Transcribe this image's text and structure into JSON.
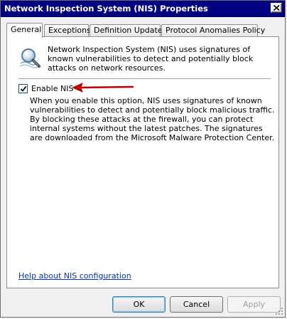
{
  "window": {
    "title": "Network Inspection System (NIS) Properties"
  },
  "tabs": [
    {
      "label": "General",
      "active": true
    },
    {
      "label": "Exceptions",
      "active": false
    },
    {
      "label": "Definition Updates",
      "active": false
    },
    {
      "label": "Protocol Anomalies Policy",
      "active": false
    }
  ],
  "general": {
    "intro_icon": "magnifier-inspection-icon",
    "intro_text": "Network Inspection System (NIS) uses signatures of known vulnerabilities to detect and potentially block attacks on network resources.",
    "enable_checkbox": {
      "label": "Enable NIS",
      "checked": true
    },
    "enable_description": "When you enable this option, NIS uses signatures of known vulnerabilities to detect and potentially block malicious traffic. By blocking these attacks at the firewall, you can protect internal systems without the latest patches. The signatures are downloaded from the Microsoft Malware Protection Center.",
    "help_link": "Help about NIS configuration"
  },
  "buttons": {
    "ok": "OK",
    "cancel": "Cancel",
    "apply": "Apply",
    "apply_enabled": false
  },
  "colors": {
    "titlebar": "#000080",
    "arrow": "#c00000",
    "link": "#0033cc"
  }
}
